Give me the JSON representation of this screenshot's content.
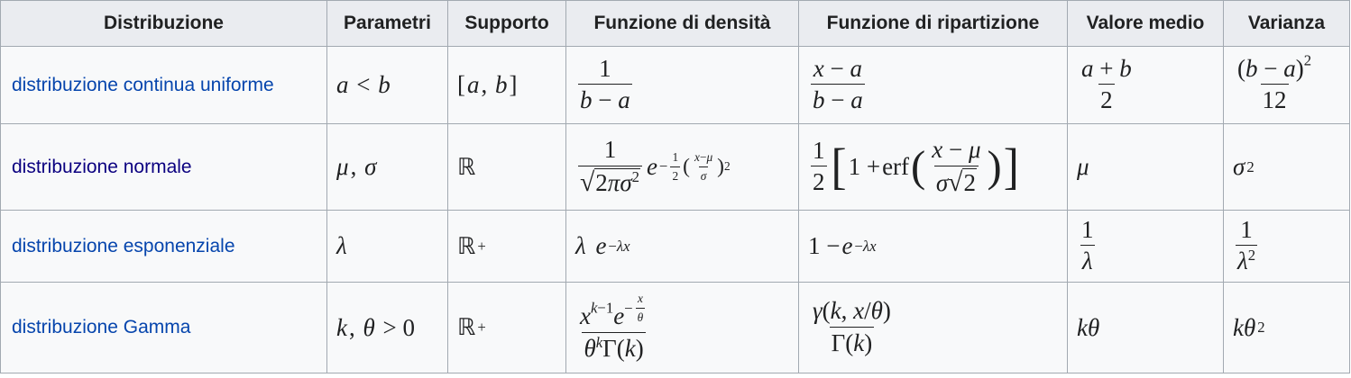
{
  "headers": [
    "Distribuzione",
    "Parametri",
    "Supporto",
    "Funzione di densità",
    "Funzione di ripartizione",
    "Valore medio",
    "Varianza"
  ],
  "rows": [
    {
      "name": "distribuzione continua uniforme"
    },
    {
      "name": "distribuzione normale"
    },
    {
      "name": "distribuzione esponenziale"
    },
    {
      "name": "distribuzione Gamma"
    }
  ],
  "colors": {
    "link": "#0645ad",
    "visited_link": "#0b0080",
    "header_bg": "#eaecf0",
    "cell_bg": "#f8f9fa",
    "border": "#a2a9b1"
  }
}
